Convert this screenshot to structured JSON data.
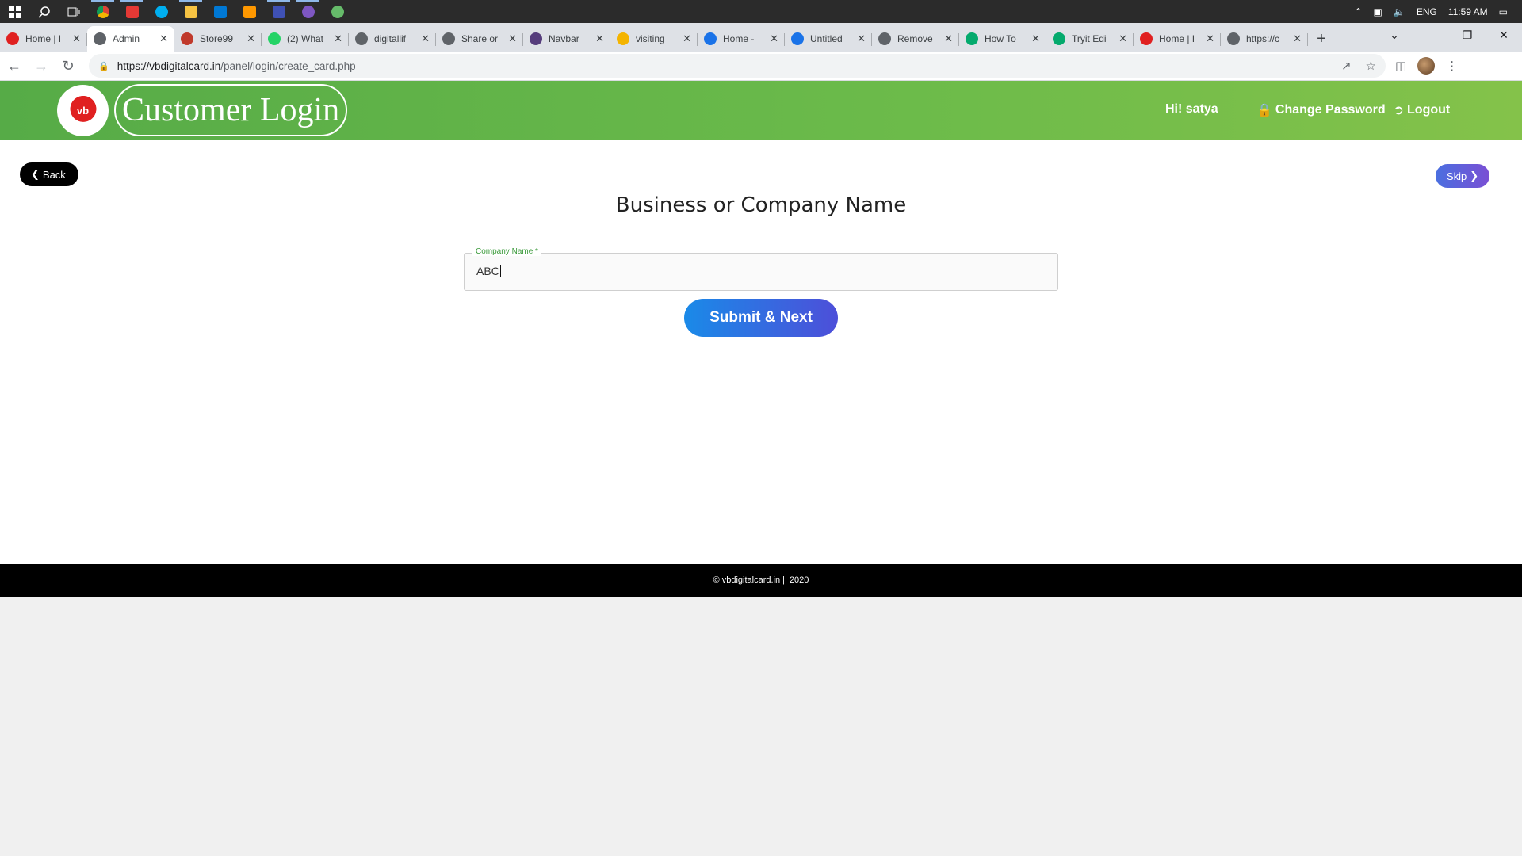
{
  "taskbar": {
    "icons": [
      "windows-start-icon",
      "search-icon",
      "task-view-icon",
      "chrome-icon",
      "app-icon",
      "skype-icon",
      "file-explorer-icon",
      "mail-icon",
      "sublime-icon",
      "app-icon",
      "github-icon",
      "app-icon"
    ],
    "language": "ENG",
    "time": "11:59 AM"
  },
  "browser": {
    "tabs": [
      {
        "title": "Home | I",
        "color": "#e02020"
      },
      {
        "title": "Admin",
        "color": "#5f6368",
        "active": true
      },
      {
        "title": "Store99",
        "color": "#c0392b"
      },
      {
        "title": "(2) What",
        "color": "#25d366"
      },
      {
        "title": "digitallif",
        "color": "#5f6368"
      },
      {
        "title": "Share or",
        "color": "#5f6368"
      },
      {
        "title": "Navbar",
        "color": "#563d7c"
      },
      {
        "title": "visiting",
        "color": "#f4b400"
      },
      {
        "title": "Home -",
        "color": "#1a73e8"
      },
      {
        "title": "Untitled",
        "color": "#1a73e8"
      },
      {
        "title": "Remove",
        "color": "#5f6368"
      },
      {
        "title": "How To",
        "color": "#04aa6d"
      },
      {
        "title": "Tryit Edi",
        "color": "#04aa6d"
      },
      {
        "title": "Home | I",
        "color": "#e02020"
      },
      {
        "title": "https://c",
        "color": "#5f6368"
      }
    ],
    "url_host": "https://vbdigitalcard.in",
    "url_path": "/panel/login/create_card.php"
  },
  "header": {
    "logo_text": "vb",
    "brand": "Customer Login",
    "greeting": "Hi! satya",
    "change_password": "Change Password",
    "logout": "Logout"
  },
  "form": {
    "back": "Back",
    "skip": "Skip",
    "title": "Business or Company Name",
    "company_label": "Company Name *",
    "company_value": "ABC",
    "submit": "Submit & Next"
  },
  "footer": {
    "text": "© vbdigitalcard.in || 2020"
  },
  "colors": {
    "header_green": "#5cb046",
    "submit_blue": "#1a8ae8",
    "skip_purple": "#5a5fe0"
  }
}
